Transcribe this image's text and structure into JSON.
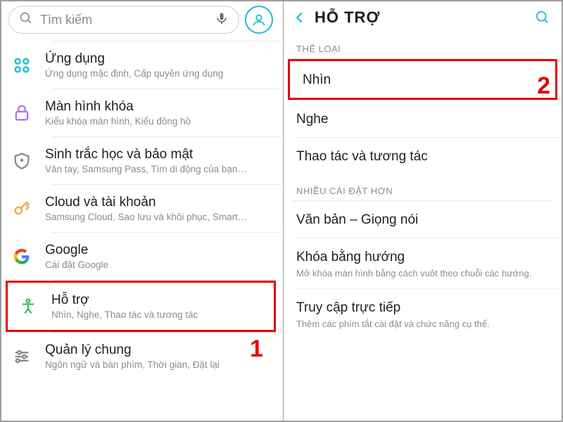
{
  "left": {
    "search_placeholder": "Tìm kiếm",
    "items": [
      {
        "title": "Ứng dụng",
        "sub": "Ứng dụng mặc định, Cấp quyền ứng dụng"
      },
      {
        "title": "Màn hình khóa",
        "sub": "Kiểu khóa màn hình, Kiểu đồng hồ"
      },
      {
        "title": "Sinh trắc học và bảo mật",
        "sub": "Vân tay, Samsung Pass, Tìm di động của bạn, ..."
      },
      {
        "title": "Cloud và tài khoản",
        "sub": "Samsung Cloud, Sao lưu và khôi phục, Smart S..."
      },
      {
        "title": "Google",
        "sub": "Cài đặt Google"
      },
      {
        "title": "Hỗ trợ",
        "sub": "Nhìn, Nghe, Thao tác và tương tác"
      },
      {
        "title": "Quản lý chung",
        "sub": "Ngôn ngữ và bàn phím, Thời gian, Đặt lại"
      }
    ],
    "badge": "1"
  },
  "right": {
    "title": "HỖ TRỢ",
    "section1": "THỂ LOẠI",
    "section2": "NHIỀU CÀI ĐẶT HƠN",
    "items1": [
      {
        "t": "Nhìn"
      },
      {
        "t": "Nghe"
      },
      {
        "t": "Thao tác và tương tác"
      }
    ],
    "items2": [
      {
        "t": "Văn bản – Giọng nói"
      },
      {
        "t": "Khóa bằng hướng",
        "s": "Mở khóa màn hình bằng cách vuốt theo chuỗi các hướng."
      },
      {
        "t": "Truy cập trực tiếp",
        "s": "Thêm các phím tắt cài đặt và chức năng cụ thể."
      }
    ],
    "badge": "2"
  }
}
